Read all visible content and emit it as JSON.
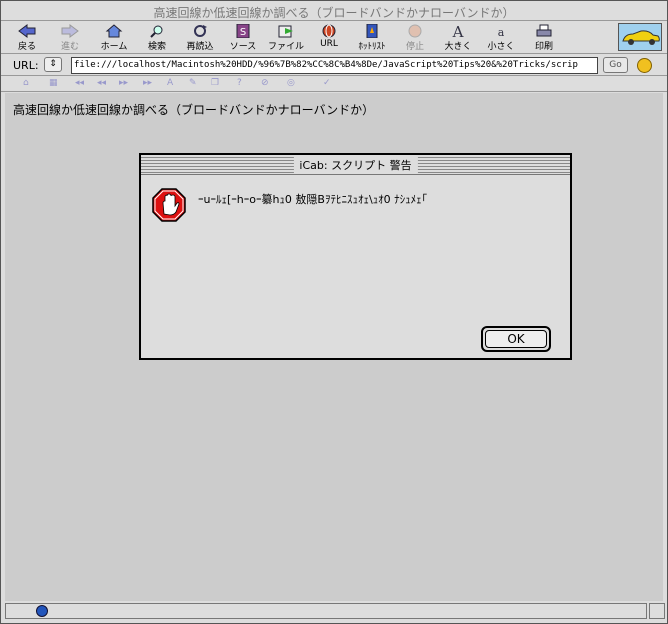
{
  "window": {
    "title": "高速回線か低速回線か調べる（ブロードバンドかナローバンドか）"
  },
  "toolbar": {
    "buttons": [
      {
        "label": "戻る",
        "icon": "back-arrow-icon",
        "enabled": true
      },
      {
        "label": "進む",
        "icon": "forward-arrow-icon",
        "enabled": false
      },
      {
        "label": "ホーム",
        "icon": "home-icon",
        "enabled": true
      },
      {
        "label": "検索",
        "icon": "magnifier-icon",
        "enabled": true
      },
      {
        "label": "再読込",
        "icon": "reload-icon",
        "enabled": true
      },
      {
        "label": "ソース",
        "icon": "source-icon",
        "enabled": true
      },
      {
        "label": "ファイル",
        "icon": "file-icon",
        "enabled": true
      },
      {
        "label": "URL",
        "icon": "globe-icon",
        "enabled": true
      },
      {
        "label": "ﾎｯﾄﾘｽﾄ",
        "icon": "hotlist-icon",
        "enabled": true
      },
      {
        "label": "停止",
        "icon": "stop-icon",
        "enabled": false
      },
      {
        "label": "大きく",
        "icon": "text-larger-icon",
        "enabled": true
      },
      {
        "label": "小さく",
        "icon": "text-smaller-icon",
        "enabled": true
      },
      {
        "label": "印刷",
        "icon": "printer-icon",
        "enabled": true
      }
    ]
  },
  "urlbar": {
    "label": "URL:",
    "value": "file:///localhost/Macintosh%20HDD/%96%7B%82%CC%8C%B4%8De/JavaScript%20Tips%20&%20Tricks/scrip",
    "go_label": "Go"
  },
  "page": {
    "heading": "高速回線か低速回線か調べる（ブロードバンドかナローバンドか）"
  },
  "dialog": {
    "title": "iCab: スクリプト 警告",
    "message": "ｰuｰﾙｪ[ｰhｰoｰ纂hｭ0 敖隠Bｦﾃﾋﾆｽｭｵｪ\\ｭｵ0 ﾅｼｭﾒｪ｢",
    "ok_label": "OK"
  },
  "colors": {
    "chrome": "#dddddd",
    "content_bg": "#cccccc",
    "stop_red": "#dd1111"
  }
}
